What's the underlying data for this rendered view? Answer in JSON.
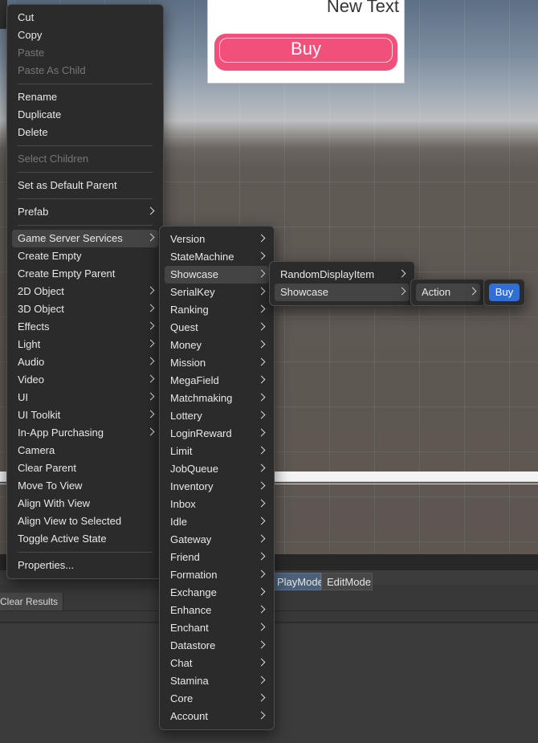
{
  "scene": {
    "canvas_text": "New Text",
    "canvas_button_label": "Buy"
  },
  "bottom_panel": {
    "mode_tabs": [
      "PlayMode",
      "EditMode"
    ],
    "clear_results": "Clear Results"
  },
  "context_menu": {
    "items": [
      {
        "label": "Cut"
      },
      {
        "label": "Copy"
      },
      {
        "label": "Paste",
        "disabled": true
      },
      {
        "label": "Paste As Child",
        "disabled": true
      },
      {
        "separator": true
      },
      {
        "label": "Rename"
      },
      {
        "label": "Duplicate"
      },
      {
        "label": "Delete"
      },
      {
        "separator": true
      },
      {
        "label": "Select Children",
        "disabled": true
      },
      {
        "separator": true
      },
      {
        "label": "Set as Default Parent"
      },
      {
        "separator": true
      },
      {
        "label": "Prefab",
        "submenu": true
      },
      {
        "separator": true
      },
      {
        "label": "Game Server Services",
        "submenu": true,
        "active": true
      },
      {
        "label": "Create Empty"
      },
      {
        "label": "Create Empty Parent"
      },
      {
        "label": "2D Object",
        "submenu": true
      },
      {
        "label": "3D Object",
        "submenu": true
      },
      {
        "label": "Effects",
        "submenu": true
      },
      {
        "label": "Light",
        "submenu": true
      },
      {
        "label": "Audio",
        "submenu": true
      },
      {
        "label": "Video",
        "submenu": true
      },
      {
        "label": "UI",
        "submenu": true
      },
      {
        "label": "UI Toolkit",
        "submenu": true
      },
      {
        "label": "In-App Purchasing",
        "submenu": true
      },
      {
        "label": "Camera"
      },
      {
        "label": "Clear Parent"
      },
      {
        "label": "Move To View"
      },
      {
        "label": "Align With View"
      },
      {
        "label": "Align View to Selected"
      },
      {
        "label": "Toggle Active State"
      },
      {
        "separator": true
      },
      {
        "label": "Properties..."
      }
    ]
  },
  "gss_submenu": {
    "items": [
      {
        "label": "Version",
        "submenu": true
      },
      {
        "label": "StateMachine",
        "submenu": true
      },
      {
        "label": "Showcase",
        "submenu": true,
        "active": true
      },
      {
        "label": "SerialKey",
        "submenu": true
      },
      {
        "label": "Ranking",
        "submenu": true
      },
      {
        "label": "Quest",
        "submenu": true
      },
      {
        "label": "Money",
        "submenu": true
      },
      {
        "label": "Mission",
        "submenu": true
      },
      {
        "label": "MegaField",
        "submenu": true
      },
      {
        "label": "Matchmaking",
        "submenu": true
      },
      {
        "label": "Lottery",
        "submenu": true
      },
      {
        "label": "LoginReward",
        "submenu": true
      },
      {
        "label": "Limit",
        "submenu": true
      },
      {
        "label": "JobQueue",
        "submenu": true
      },
      {
        "label": "Inventory",
        "submenu": true
      },
      {
        "label": "Inbox",
        "submenu": true
      },
      {
        "label": "Idle",
        "submenu": true
      },
      {
        "label": "Gateway",
        "submenu": true
      },
      {
        "label": "Friend",
        "submenu": true
      },
      {
        "label": "Formation",
        "submenu": true
      },
      {
        "label": "Exchange",
        "submenu": true
      },
      {
        "label": "Enhance",
        "submenu": true
      },
      {
        "label": "Enchant",
        "submenu": true
      },
      {
        "label": "Datastore",
        "submenu": true
      },
      {
        "label": "Chat",
        "submenu": true
      },
      {
        "label": "Stamina",
        "submenu": true
      },
      {
        "label": "Core",
        "submenu": true
      },
      {
        "label": "Account",
        "submenu": true
      }
    ]
  },
  "showcase_submenu": {
    "items": [
      {
        "label": "RandomDisplayItem",
        "submenu": true
      },
      {
        "label": "Showcase",
        "submenu": true,
        "active": true
      }
    ]
  },
  "showcase_sub_submenu": {
    "items": [
      {
        "label": "Action",
        "submenu": true,
        "active": true
      }
    ]
  },
  "action_submenu": {
    "items": [
      {
        "label": "Buy",
        "selected": true
      }
    ]
  }
}
